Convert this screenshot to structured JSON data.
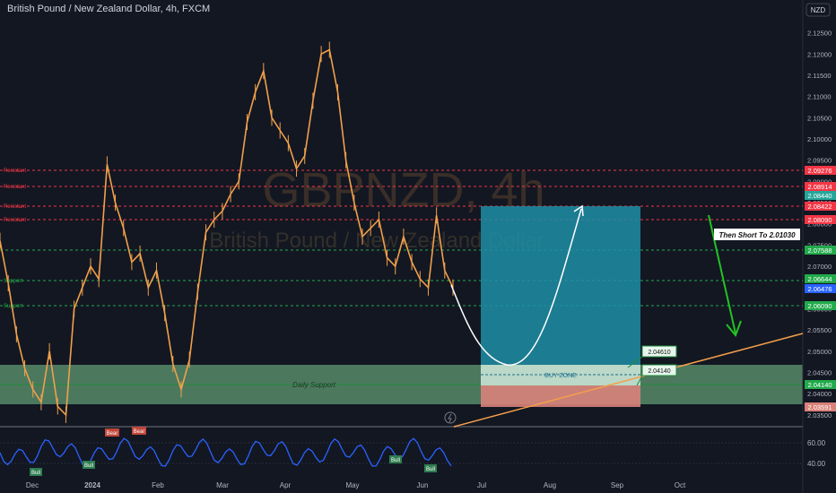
{
  "header": {
    "title": "British Pound / New Zealand Dollar, 4h, FXCM",
    "currency": "NZD"
  },
  "watermark": {
    "symbol": "GBPNZD, 4h",
    "name": "British Pound / New Zealand Dollar"
  },
  "colors": {
    "background": "#131722",
    "candle": "#f0a04b",
    "resistance": "#f23645",
    "support": "#22ab4b",
    "buy_zone": "#5b9b7a",
    "target_box": "#1f8ea6",
    "stop_box": "#d9827a",
    "trendline": "#f5a04a",
    "arrow": "#22c322"
  },
  "chart_data": {
    "type": "line",
    "title": "British Pound / New Zealand Dollar, 4h, FXCM",
    "x_tick_labels": [
      "Dec",
      "2024",
      "Feb",
      "Mar",
      "Apr",
      "May",
      "Jun",
      "Jul",
      "Aug",
      "Sep",
      "Oct"
    ],
    "y_tick_labels": [
      "2.12500",
      "2.12000",
      "2.11500",
      "2.11000",
      "2.10500",
      "2.10000",
      "2.09500",
      "2.09000",
      "2.08500",
      "2.08000",
      "2.07500",
      "2.07000",
      "2.06500",
      "2.06000",
      "2.05500",
      "2.05000",
      "2.04500",
      "2.04000",
      "2.03500"
    ],
    "ylim": [
      2.0335,
      2.1285
    ],
    "series": [
      {
        "values": [
          2.076,
          2.066,
          2.054,
          2.046,
          2.041,
          2.038,
          2.05,
          2.037,
          2.035,
          2.06,
          2.065,
          2.07,
          2.067,
          2.094,
          2.085,
          2.079,
          2.071,
          2.073,
          2.065,
          2.069,
          2.059,
          2.047,
          2.041,
          2.048,
          2.064,
          2.078,
          2.081,
          2.083,
          2.087,
          2.09,
          2.104,
          2.111,
          2.116,
          2.105,
          2.102,
          2.099,
          2.093,
          2.096,
          2.109,
          2.12,
          2.121,
          2.111,
          2.095,
          2.085,
          2.077,
          2.079,
          2.081,
          2.072,
          2.07,
          2.077,
          2.071,
          2.067,
          2.065,
          2.082,
          2.069,
          2.065
        ]
      }
    ],
    "levels": [
      {
        "label": "Resistant",
        "price": "2.09276"
      },
      {
        "label": "Resistant",
        "price": "2.08914"
      },
      {
        "label": "Resistant",
        "price": "2.08422"
      },
      {
        "label": "Resistant",
        "price": "2.08090"
      },
      {
        "label": "",
        "price": "2.07588"
      },
      {
        "label": "Support",
        "price": "2.06644"
      },
      {
        "label": "Support",
        "price": "2.06090"
      },
      {
        "label": "Daily Support",
        "price": "2.04140"
      }
    ],
    "price_tags": [
      "2.09276",
      "2.08914",
      "2.08440",
      "2.08422",
      "2.08090",
      "2.07588",
      "2.06644",
      "2.06476",
      "2.06090",
      "2.04140",
      "2.03591"
    ],
    "buy_zone": {
      "label": "BUY ZONE",
      "top": 2.0461,
      "bottom": 2.0414
    },
    "zone_tags": [
      "2.04610",
      "2.04140"
    ],
    "target_note": "Then Short To 2.01030",
    "oscillator": {
      "tick_labels": [
        "60.00",
        "40.00"
      ],
      "signals": [
        "Bull",
        "Bull",
        "Bear",
        "Bear",
        "Bull",
        "Bull"
      ]
    }
  }
}
